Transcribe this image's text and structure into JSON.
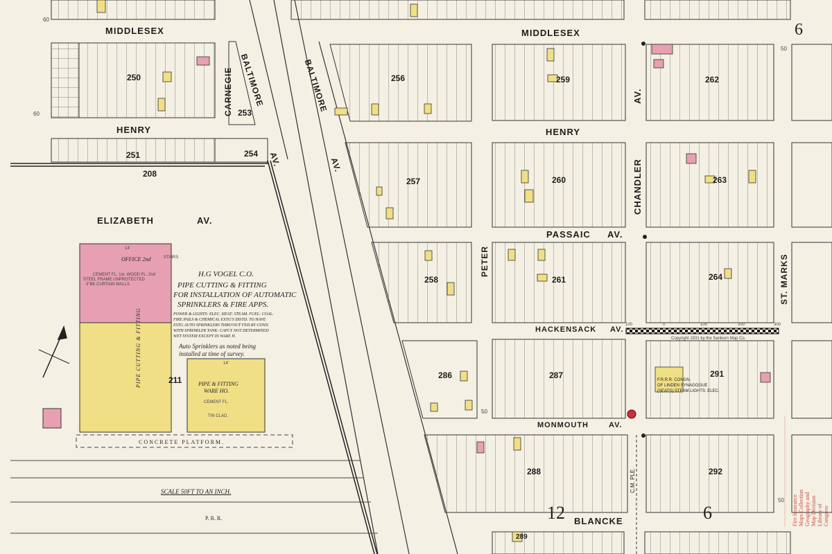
{
  "sheet_number": "6",
  "streets": {
    "middlesex_left": "MIDDLESEX",
    "middlesex_right": "MIDDLESEX",
    "henry_left": "HENRY",
    "henry_right": "HENRY",
    "elizabeth": "ELIZABETH",
    "elizabeth_av": "AV.",
    "passaic": "PASSAIC",
    "passaic_av": "AV.",
    "hackensack": "HACKENSACK",
    "hackensack_av": "AV.",
    "monmouth": "MONMOUTH",
    "monmouth_av": "AV.",
    "blancke": "BLANCKE",
    "carnegie": "CARNEGIE",
    "baltimore_1": "BALTIMORE",
    "baltimore_1_av": "AV.",
    "baltimore_2": "BALTIMORE",
    "baltimore_2_av": "AV.",
    "chandler": "CHANDLER",
    "chandler_av": "AV.",
    "peter": "PETER",
    "st_marks": "ST. MARKS",
    "cmple": "C.M. PLE."
  },
  "blocks": {
    "b250": "250",
    "b251": "251",
    "b253": "253",
    "b254": "254",
    "b256": "256",
    "b257": "257",
    "b258": "258",
    "b259": "259",
    "b260": "260",
    "b261": "261",
    "b262": "262",
    "b263": "263",
    "b264": "264",
    "b208": "208",
    "b211": "211",
    "b286": "286",
    "b287": "287",
    "b288": "288",
    "b289": "289",
    "b291": "291",
    "b292": "292"
  },
  "big_numbers": {
    "twelve": "12",
    "six": "6"
  },
  "factory": {
    "name": "H.G VOGEL C.O.",
    "line1": "PIPE CUTTING & FITTING",
    "line2": "FOR INSTALLATION OF AUTOMATIC",
    "line3": "SPRINKLERS & FIRE APPS.",
    "details1": "POWER & LIGHTS: ELEC. HEAT: STEAM. FUEL: COAL.",
    "details2": "FIRE PAILS & CHEMICAL EXTG'S DISTD. TO HAVE",
    "details3": "ESTG AUTO SPRINKLERS THRO'OUT FED BY CONN.",
    "details4": "WITH SPRINKLER TANK: CAPCY NOT DETERMINED",
    "details5": "WET SYSTEM EXCEPT IN WARE H.",
    "auto1": "Auto Sprinklers as noted being",
    "auto2": "installed at time of survey.",
    "vertical_label": "PIPE CUTTING & FITTING",
    "office": "OFFICE 2nd",
    "stairs": "STAIRS",
    "construction1": "CEMENT FL. 1st. WOOD FL. 2nd",
    "construction2": "STEEL FRAME UNPROTECTED",
    "construction3": "3\"BK CURTAIN WALLS",
    "ware1": "PIPE & FITTING",
    "ware2": "WARE HO.",
    "ware3": "CEMENT FL.",
    "ware4": "TIN CLAD.",
    "height": "14'",
    "height2": "14'"
  },
  "platform": "CONCRETE PLATFORM.",
  "scale": "SCALE 50FT TO AN INCH.",
  "railroad": "P.   R.   R.",
  "synagogue1": "F.R.R.R. CONGN.",
  "synagogue2": "OF LINDEN SYNAGOGUE",
  "synagogue3": "(SEATS) STEAM.LIGHTS: ELEC.",
  "copyright": "Copyright 1931 by the Sanborn Map Co.",
  "dimensions": {
    "d60": "60",
    "d50": "50",
    "d100": "100",
    "d0": "0",
    "d200": "200",
    "d300": "300"
  },
  "stamp": {
    "l1": "Fire Insurance Maps Collection",
    "l2": "Geography and Map Division",
    "l3": "Library of Congress"
  },
  "colors": {
    "brick": "#e7a0b1",
    "frame": "#f1df86",
    "paper": "#f4f0e3",
    "ink": "#2a2a2a",
    "hydrant": "#c8333a"
  }
}
